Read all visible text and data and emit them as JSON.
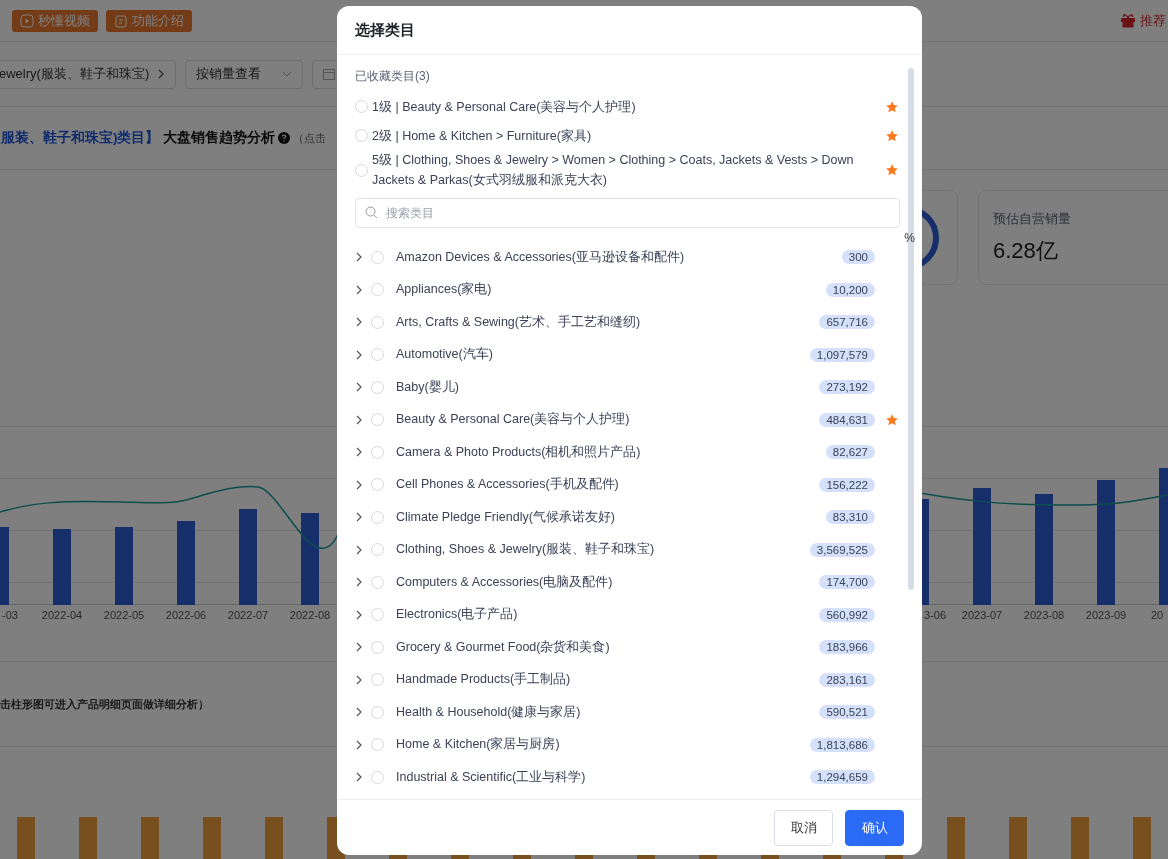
{
  "top_bar": {
    "buttons": [
      {
        "label": "秒懂视频",
        "kind": "video"
      },
      {
        "label": "功能介绍",
        "kind": "intro"
      }
    ],
    "recommend": "推荐"
  },
  "filters": {
    "category": "ewelry(服装、鞋子和珠宝)",
    "sort": "按销量查看"
  },
  "section_title": {
    "category": "服装、鞋子和珠宝)类目】",
    "title": "大盘销售趋势分析",
    "hint": "（点击"
  },
  "cards": [
    {
      "value": "%",
      "kind": "donut"
    },
    {
      "label": "预估自营销量",
      "value": "6.28亿",
      "kind": "stat"
    }
  ],
  "chart": {
    "left_labels": [
      "-03",
      "2022-04",
      "2022-05",
      "2022-06",
      "2022-07",
      "2022-08"
    ],
    "right_labels": [
      "3-06",
      "2023-07",
      "2023-08",
      "2023-09",
      "20"
    ]
  },
  "chart_hint": "击柱形图可进入产品明细页面做详细分析）",
  "dialog": {
    "title": "选择类目",
    "favorites_heading": "已收藏类目(3)",
    "favorites": [
      {
        "label": "1级 | Beauty & Personal Care(美容与个人护理)",
        "selected": false,
        "starred": true
      },
      {
        "label": "2级 | Home & Kitchen > Furniture(家具)",
        "selected": false,
        "starred": true
      },
      {
        "label": "5级 | Clothing, Shoes & Jewelry > Women > Clothing > Coats, Jackets & Vests > Down Jackets & Parkas(女式羽绒服和派克大衣)",
        "selected": false,
        "starred": true
      }
    ],
    "search": {
      "placeholder": "搜索类目"
    },
    "categories": [
      {
        "label": "Amazon Devices & Accessories(亚马逊设备和配件)",
        "count": "300",
        "selected": false,
        "starred": false
      },
      {
        "label": "Appliances(家电)",
        "count": "10,200",
        "selected": false,
        "starred": false
      },
      {
        "label": "Arts, Crafts & Sewing(艺术、手工艺和缝纫)",
        "count": "657,716",
        "selected": false,
        "starred": false
      },
      {
        "label": "Automotive(汽车)",
        "count": "1,097,579",
        "selected": false,
        "starred": false
      },
      {
        "label": "Baby(婴儿)",
        "count": "273,192",
        "selected": false,
        "starred": false
      },
      {
        "label": "Beauty & Personal Care(美容与个人护理)",
        "count": "484,631",
        "selected": false,
        "starred": true
      },
      {
        "label": "Camera & Photo Products(相机和照片产品)",
        "count": "82,627",
        "selected": false,
        "starred": false
      },
      {
        "label": "Cell Phones & Accessories(手机及配件)",
        "count": "156,222",
        "selected": false,
        "starred": false
      },
      {
        "label": "Climate Pledge Friendly(气候承诺友好)",
        "count": "83,310",
        "selected": false,
        "starred": false
      },
      {
        "label": "Clothing, Shoes & Jewelry(服装、鞋子和珠宝)",
        "count": "3,569,525",
        "selected": false,
        "starred": false
      },
      {
        "label": "Computers & Accessories(电脑及配件)",
        "count": "174,700",
        "selected": false,
        "starred": false
      },
      {
        "label": "Electronics(电子产品)",
        "count": "560,992",
        "selected": false,
        "starred": false
      },
      {
        "label": "Grocery & Gourmet Food(杂货和美食)",
        "count": "183,966",
        "selected": false,
        "starred": false
      },
      {
        "label": "Handmade Products(手工制品)",
        "count": "283,161",
        "selected": false,
        "starred": false
      },
      {
        "label": "Health & Household(健康与家居)",
        "count": "590,521",
        "selected": false,
        "starred": false
      },
      {
        "label": "Home & Kitchen(家居与厨房)",
        "count": "1,813,686",
        "selected": false,
        "starred": false
      },
      {
        "label": "Industrial & Scientific(工业与科学)",
        "count": "1,294,659",
        "selected": false,
        "starred": false
      }
    ],
    "buttons": [
      {
        "label": "取消",
        "kind": "secondary"
      },
      {
        "label": "确认",
        "kind": "primary"
      }
    ]
  }
}
